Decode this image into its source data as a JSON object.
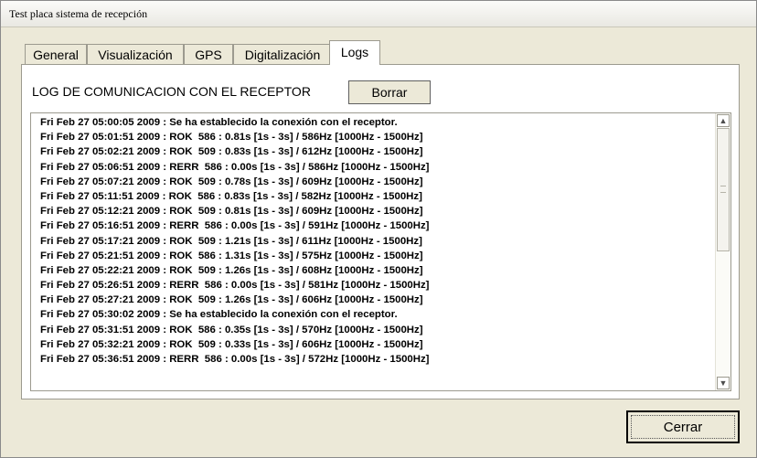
{
  "window": {
    "title": "Test placa sistema de recepción"
  },
  "tabs": [
    {
      "label": "General"
    },
    {
      "label": "Visualización"
    },
    {
      "label": "GPS"
    },
    {
      "label": "Digitalización"
    },
    {
      "label": "Logs"
    }
  ],
  "active_tab": "Logs",
  "panel": {
    "title": "LOG DE COMUNICACION CON EL RECEPTOR",
    "clear_button": "Borrar"
  },
  "log_lines": [
    "Fri Feb 27 05:00:05 2009 : Se ha establecido la conexión con el receptor.",
    "Fri Feb 27 05:01:51 2009 : ROK  586 : 0.81s [1s - 3s] / 586Hz [1000Hz - 1500Hz]",
    "Fri Feb 27 05:02:21 2009 : ROK  509 : 0.83s [1s - 3s] / 612Hz [1000Hz - 1500Hz]",
    "Fri Feb 27 05:06:51 2009 : RERR  586 : 0.00s [1s - 3s] / 586Hz [1000Hz - 1500Hz]",
    "Fri Feb 27 05:07:21 2009 : ROK  509 : 0.78s [1s - 3s] / 609Hz [1000Hz - 1500Hz]",
    "Fri Feb 27 05:11:51 2009 : ROK  586 : 0.83s [1s - 3s] / 582Hz [1000Hz - 1500Hz]",
    "Fri Feb 27 05:12:21 2009 : ROK  509 : 0.81s [1s - 3s] / 609Hz [1000Hz - 1500Hz]",
    "Fri Feb 27 05:16:51 2009 : RERR  586 : 0.00s [1s - 3s] / 591Hz [1000Hz - 1500Hz]",
    "Fri Feb 27 05:17:21 2009 : ROK  509 : 1.21s [1s - 3s] / 611Hz [1000Hz - 1500Hz]",
    "Fri Feb 27 05:21:51 2009 : ROK  586 : 1.31s [1s - 3s] / 575Hz [1000Hz - 1500Hz]",
    "Fri Feb 27 05:22:21 2009 : ROK  509 : 1.26s [1s - 3s] / 608Hz [1000Hz - 1500Hz]",
    "Fri Feb 27 05:26:51 2009 : RERR  586 : 0.00s [1s - 3s] / 581Hz [1000Hz - 1500Hz]",
    "Fri Feb 27 05:27:21 2009 : ROK  509 : 1.26s [1s - 3s] / 606Hz [1000Hz - 1500Hz]",
    "Fri Feb 27 05:30:02 2009 : Se ha establecido la conexión con el receptor.",
    "Fri Feb 27 05:31:51 2009 : ROK  586 : 0.35s [1s - 3s] / 570Hz [1000Hz - 1500Hz]",
    "Fri Feb 27 05:32:21 2009 : ROK  509 : 0.33s [1s - 3s] / 606Hz [1000Hz - 1500Hz]",
    "Fri Feb 27 05:36:51 2009 : RERR  586 : 0.00s [1s - 3s] / 572Hz [1000Hz - 1500Hz]"
  ],
  "close_button": "Cerrar",
  "icons": {
    "scroll_up": "scroll-up-arrow-icon",
    "scroll_down": "scroll-down-arrow-icon"
  }
}
